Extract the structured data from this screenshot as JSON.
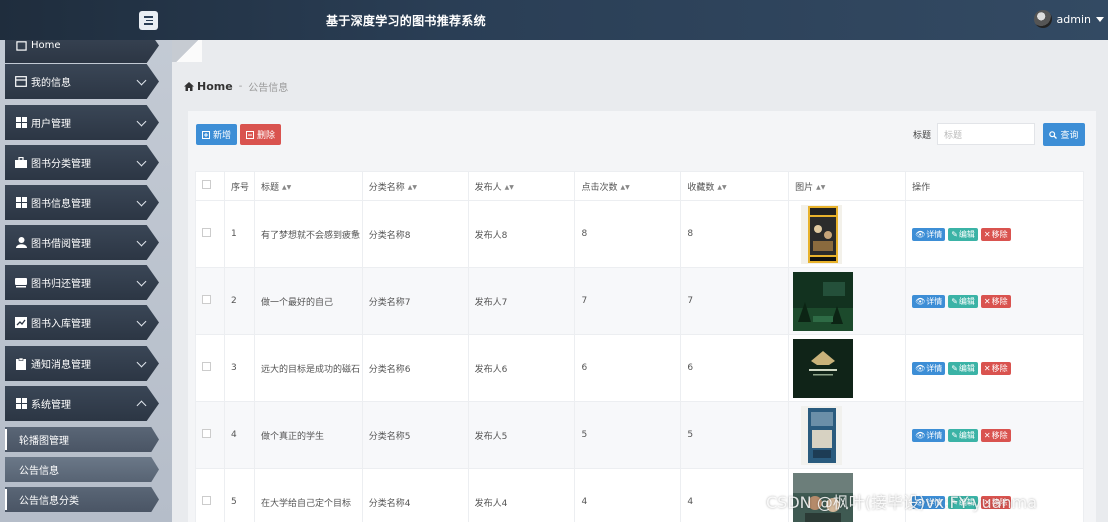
{
  "topbar": {
    "title": "基于深度学习的图书推荐系统",
    "user": "admin"
  },
  "sidebar": {
    "items": [
      {
        "label": "Home",
        "icon": "home-icon"
      },
      {
        "label": "我的信息",
        "icon": "profile-icon"
      },
      {
        "label": "用户管理",
        "icon": "grid-icon"
      },
      {
        "label": "图书分类管理",
        "icon": "briefcase-icon"
      },
      {
        "label": "图书信息管理",
        "icon": "grid-icon"
      },
      {
        "label": "图书借阅管理",
        "icon": "user-icon"
      },
      {
        "label": "图书归还管理",
        "icon": "book-icon"
      },
      {
        "label": "图书入库管理",
        "icon": "chart-icon"
      },
      {
        "label": "通知消息管理",
        "icon": "clipboard-icon"
      },
      {
        "label": "系统管理",
        "icon": "grid-icon"
      }
    ],
    "sub_items": [
      "轮播图管理",
      "公告信息",
      "公告信息分类"
    ]
  },
  "breadcrumb": {
    "home": "Home",
    "sep": "-",
    "current": "公告信息"
  },
  "toolbar": {
    "add_label": "新增",
    "delete_label": "删除",
    "search_label": "标题",
    "search_placeholder": "标题",
    "search_button": "查询"
  },
  "table": {
    "headers": [
      "序号",
      "标题",
      "分类名称",
      "发布人",
      "点击次数",
      "收藏数",
      "图片",
      "操作"
    ],
    "rows": [
      {
        "no": "1",
        "title": "有了梦想就不会感到疲惫",
        "category": "分类名称8",
        "publisher": "发布人8",
        "clicks": "8",
        "favorites": "8"
      },
      {
        "no": "2",
        "title": "做一个最好的自己",
        "category": "分类名称7",
        "publisher": "发布人7",
        "clicks": "7",
        "favorites": "7"
      },
      {
        "no": "3",
        "title": "远大的目标是成功的磁石",
        "category": "分类名称6",
        "publisher": "发布人6",
        "clicks": "6",
        "favorites": "6"
      },
      {
        "no": "4",
        "title": "做个真正的学生",
        "category": "分类名称5",
        "publisher": "发布人5",
        "clicks": "5",
        "favorites": "5"
      },
      {
        "no": "5",
        "title": "在大学给自己定个目标",
        "category": "分类名称4",
        "publisher": "发布人4",
        "clicks": "4",
        "favorites": "4"
      }
    ],
    "actions": {
      "detail": "详情",
      "edit": "编辑",
      "remove": "移除"
    }
  },
  "watermark": "CSDN @枫叶(接毕设)vx:FY-yuanma"
}
